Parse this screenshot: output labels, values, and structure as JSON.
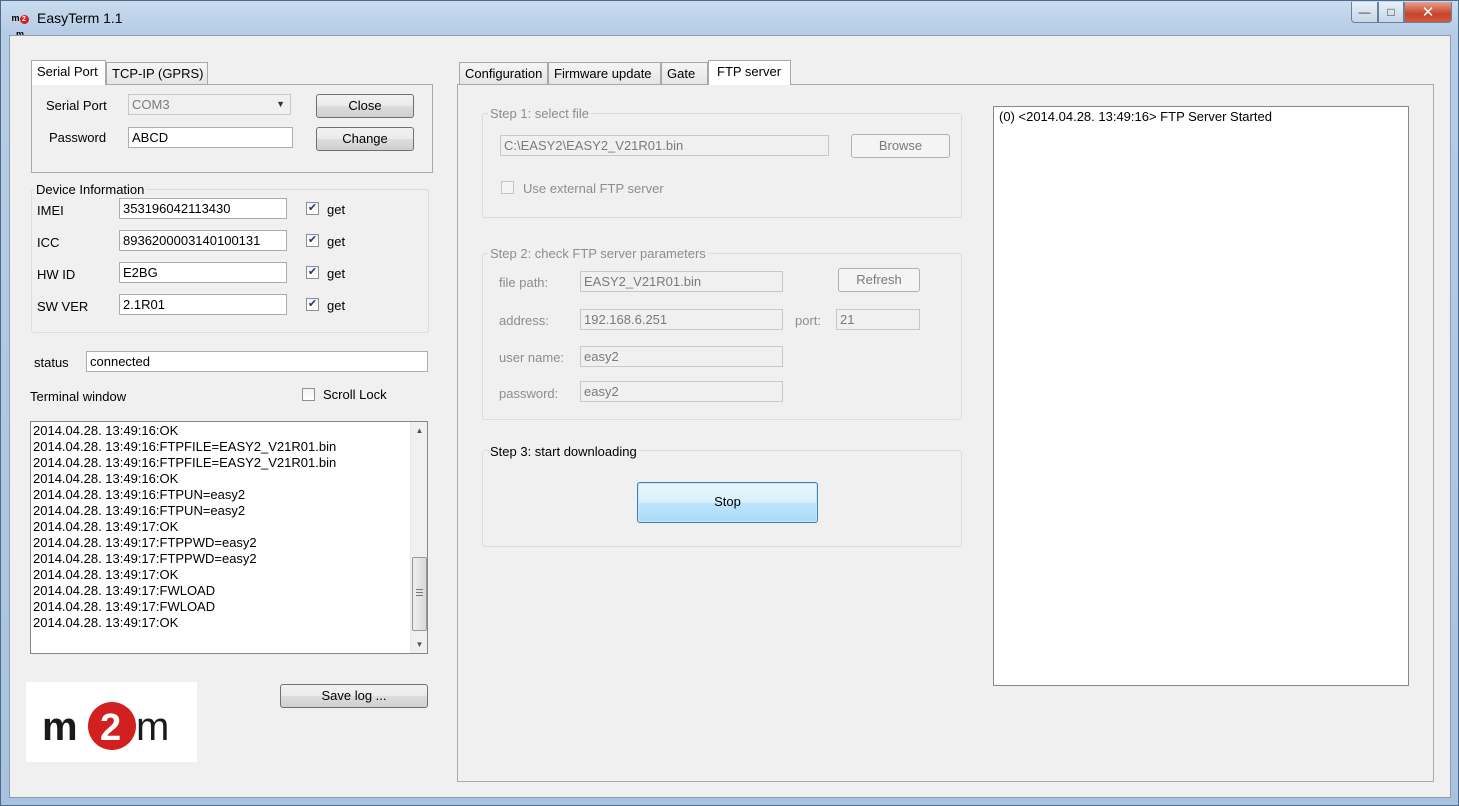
{
  "window": {
    "title": "EasyTerm 1.1",
    "logo_text": "m2m"
  },
  "left_tabs": [
    "Serial Port",
    "TCP-IP (GPRS)"
  ],
  "serial": {
    "port_label": "Serial Port",
    "port_value": "COM3",
    "password_label": "Password",
    "password_value": "ABCD",
    "close_button": "Close",
    "change_button": "Change"
  },
  "device_info": {
    "title": "Device Information",
    "get_label": "get",
    "fields": [
      {
        "label": "IMEI",
        "value": "353196042113430",
        "checked": true
      },
      {
        "label": "ICC",
        "value": "8936200003140100131",
        "checked": true
      },
      {
        "label": "HW ID",
        "value": "E2BG",
        "checked": true
      },
      {
        "label": "SW VER",
        "value": "2.1R01",
        "checked": true
      }
    ]
  },
  "status": {
    "label": "status",
    "value": "connected"
  },
  "terminal": {
    "label": "Terminal window",
    "scroll_lock_label": "Scroll Lock",
    "scroll_lock_checked": false,
    "lines": [
      "2014.04.28. 13:49:16:OK",
      "2014.04.28. 13:49:16:FTPFILE=EASY2_V21R01.bin",
      "2014.04.28. 13:49:16:FTPFILE=EASY2_V21R01.bin",
      "2014.04.28. 13:49:16:OK",
      "2014.04.28. 13:49:16:FTPUN=easy2",
      "2014.04.28. 13:49:16:FTPUN=easy2",
      "2014.04.28. 13:49:17:OK",
      "2014.04.28. 13:49:17:FTPPWD=easy2",
      "2014.04.28. 13:49:17:FTPPWD=easy2",
      "2014.04.28. 13:49:17:OK",
      "2014.04.28. 13:49:17:FWLOAD",
      "2014.04.28. 13:49:17:FWLOAD",
      "2014.04.28. 13:49:17:OK"
    ],
    "save_button": "Save log ..."
  },
  "brand_logo": {
    "text_left": "m",
    "text_circle": "2",
    "text_right": "m",
    "accent": "#d21f1f"
  },
  "main_tabs": [
    "Configuration",
    "Firmware update",
    "Gate",
    "FTP server"
  ],
  "ftp": {
    "step1": {
      "title": "Step 1: select file",
      "file_value": "C:\\EASY2\\EASY2_V21R01.bin",
      "browse_button": "Browse",
      "external_label": "Use external FTP server"
    },
    "step2": {
      "title": "Step 2: check FTP server parameters",
      "file_path_label": "file path:",
      "file_path_value": "EASY2_V21R01.bin",
      "refresh_button": "Refresh",
      "address_label": "address:",
      "address_value": "192.168.6.251",
      "port_label": "port:",
      "port_value": "21",
      "user_label": "user name:",
      "user_value": "easy2",
      "password_label": "password:",
      "password_value": "easy2"
    },
    "step3": {
      "title": "Step 3: start downloading",
      "stop_button": "Stop"
    },
    "log_lines": [
      "(0) <2014.04.28. 13:49:16> FTP Server Started"
    ]
  }
}
